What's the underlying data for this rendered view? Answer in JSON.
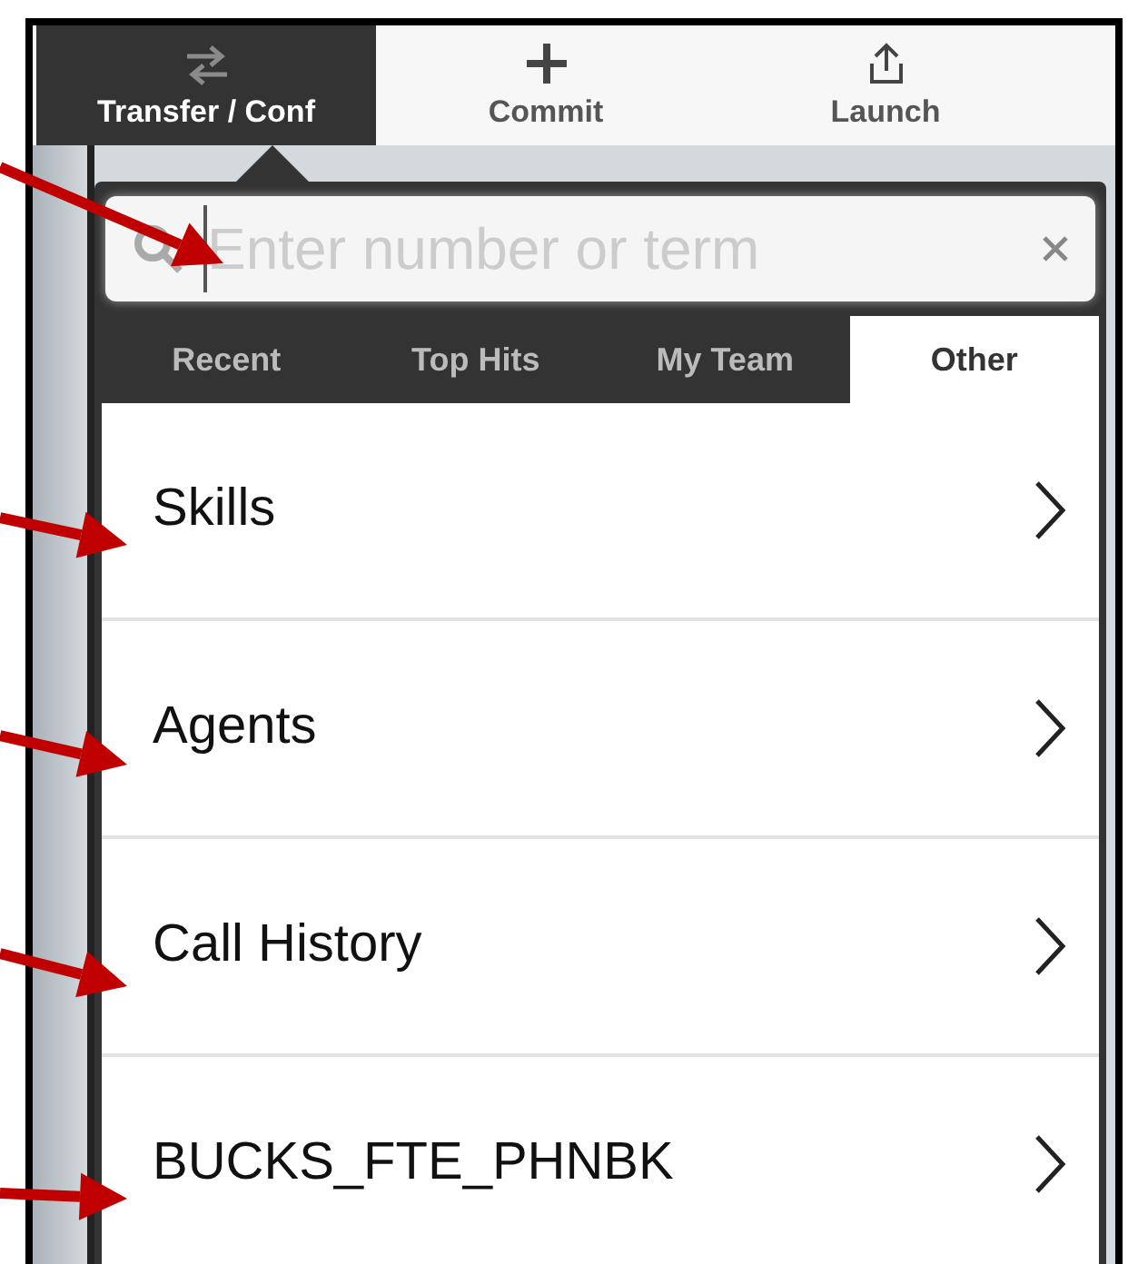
{
  "toolbar": [
    {
      "label": "Transfer / Conf",
      "kind": "transfer",
      "selected": true
    },
    {
      "label": "Commit",
      "kind": "plus",
      "selected": false
    },
    {
      "label": "Launch",
      "kind": "share",
      "selected": false
    }
  ],
  "search": {
    "placeholder": "Enter number or term"
  },
  "tabs": [
    {
      "label": "Recent",
      "selected": false
    },
    {
      "label": "Top Hits",
      "selected": false
    },
    {
      "label": "My Team",
      "selected": false
    },
    {
      "label": "Other",
      "selected": true
    }
  ],
  "items": [
    {
      "label": "Skills"
    },
    {
      "label": "Agents"
    },
    {
      "label": "Call History"
    },
    {
      "label": "BUCKS_FTE_PHNBK"
    }
  ]
}
